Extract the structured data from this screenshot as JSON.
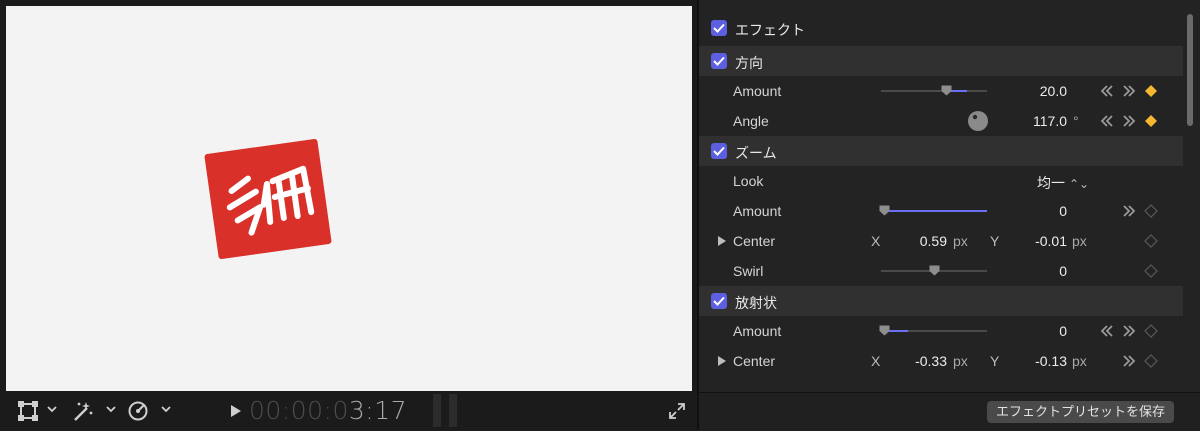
{
  "viewer": {
    "timecode_dim": "00:00:0",
    "timecode_lit": "3:17"
  },
  "inspector": {
    "effects_header": "エフェクト",
    "sections": {
      "direction": {
        "title": "方向",
        "amount_label": "Amount",
        "amount_value": "20.0",
        "amount_level": 0.2,
        "angle_label": "Angle",
        "angle_value": "117.0",
        "angle_unit": "°"
      },
      "zoom": {
        "title": "ズーム",
        "look_label": "Look",
        "look_value": "均一",
        "amount_label": "Amount",
        "amount_value": "0",
        "center_label": "Center",
        "center_x_axis": "X",
        "center_x_value": "0.59",
        "center_x_unit": "px",
        "center_y_axis": "Y",
        "center_y_value": "-0.01",
        "center_y_unit": "px",
        "swirl_label": "Swirl",
        "swirl_value": "0"
      },
      "radial": {
        "title": "放射状",
        "amount_label": "Amount",
        "amount_value": "0",
        "center_label": "Center",
        "center_x_axis": "X",
        "center_x_value": "-0.33",
        "center_x_unit": "px",
        "center_y_axis": "Y",
        "center_y_value": "-0.13",
        "center_y_unit": "px"
      }
    },
    "save_preset_label": "エフェクトプリセットを保存"
  },
  "colors": {
    "accent": "#5b5fe0",
    "keyframe_active": "#f5b72f",
    "stamp_red": "#d9302a"
  },
  "icons": [
    "transform-icon",
    "magic-wand-icon",
    "speed-icon",
    "play-icon",
    "fullscreen-icon",
    "keyframe-prev-icon",
    "keyframe-next-icon",
    "keyframe-diamond-icon"
  ]
}
